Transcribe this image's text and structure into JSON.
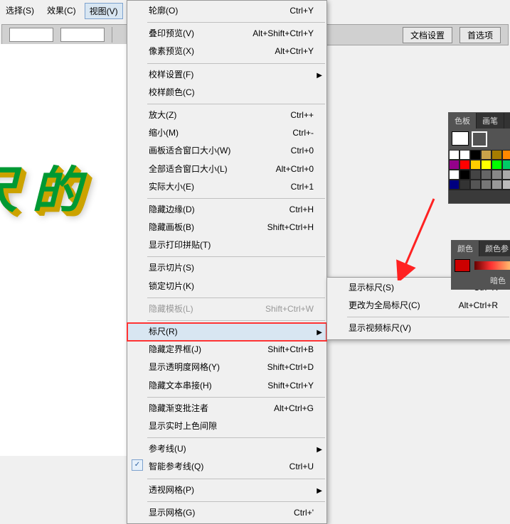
{
  "menubar": {
    "items": [
      "选择(S)",
      "效果(C)",
      "视图(V)"
    ]
  },
  "toolbar": {
    "btn1": "文档设置",
    "btn2": "首选项"
  },
  "canvas_text": "尺 的",
  "menu": {
    "items": [
      {
        "label": "轮廓(O)",
        "shortcut": "Ctrl+Y"
      },
      {
        "sep": true
      },
      {
        "label": "叠印预览(V)",
        "shortcut": "Alt+Shift+Ctrl+Y"
      },
      {
        "label": "像素预览(X)",
        "shortcut": "Alt+Ctrl+Y"
      },
      {
        "sep": true
      },
      {
        "label": "校样设置(F)",
        "submenu": true
      },
      {
        "label": "校样颜色(C)"
      },
      {
        "sep": true
      },
      {
        "label": "放大(Z)",
        "shortcut": "Ctrl++"
      },
      {
        "label": "缩小(M)",
        "shortcut": "Ctrl+-"
      },
      {
        "label": "画板适合窗口大小(W)",
        "shortcut": "Ctrl+0"
      },
      {
        "label": "全部适合窗口大小(L)",
        "shortcut": "Alt+Ctrl+0"
      },
      {
        "label": "实际大小(E)",
        "shortcut": "Ctrl+1"
      },
      {
        "sep": true
      },
      {
        "label": "隐藏边缘(D)",
        "shortcut": "Ctrl+H"
      },
      {
        "label": "隐藏画板(B)",
        "shortcut": "Shift+Ctrl+H"
      },
      {
        "label": "显示打印拼贴(T)"
      },
      {
        "sep": true
      },
      {
        "label": "显示切片(S)"
      },
      {
        "label": "锁定切片(K)"
      },
      {
        "sep": true
      },
      {
        "label": "隐藏模板(L)",
        "shortcut": "Shift+Ctrl+W",
        "disabled": true
      },
      {
        "sep": true
      },
      {
        "label": "标尺(R)",
        "submenu": true,
        "highlight": true
      },
      {
        "label": "隐藏定界框(J)",
        "shortcut": "Shift+Ctrl+B"
      },
      {
        "label": "显示透明度网格(Y)",
        "shortcut": "Shift+Ctrl+D"
      },
      {
        "label": "隐藏文本串接(H)",
        "shortcut": "Shift+Ctrl+Y"
      },
      {
        "sep": true
      },
      {
        "label": "隐藏渐变批注者",
        "shortcut": "Alt+Ctrl+G"
      },
      {
        "label": "显示实时上色间隙"
      },
      {
        "sep": true
      },
      {
        "label": "参考线(U)",
        "submenu": true
      },
      {
        "label": "智能参考线(Q)",
        "shortcut": "Ctrl+U",
        "checked": true
      },
      {
        "sep": true
      },
      {
        "label": "透视网格(P)",
        "submenu": true
      },
      {
        "sep": true
      },
      {
        "label": "显示网格(G)",
        "shortcut": "Ctrl+'"
      }
    ]
  },
  "submenu": {
    "items": [
      {
        "label": "显示标尺(S)",
        "shortcut": "Ctrl+R",
        "highlight": true
      },
      {
        "label": "更改为全局标尺(C)",
        "shortcut": "Alt+Ctrl+R"
      },
      {
        "sep": true
      },
      {
        "label": "显示视频标尺(V)"
      }
    ]
  },
  "swatch_panel": {
    "tabs": [
      "色板",
      "画笔",
      "符"
    ]
  },
  "color_panel": {
    "tabs": [
      "颜色",
      "颜色参"
    ],
    "label": "暗色"
  },
  "swatch_colors": [
    "#ffffff",
    "#ffffff",
    "#000000",
    "#c8a14a",
    "#a67c00",
    "#ff8800",
    "#336600",
    "#339933",
    "#66cc66",
    "#94008a",
    "#ff0000",
    "#ffcc00",
    "#ffff00",
    "#00ff00",
    "#00cc66",
    "#00ffff",
    "#0066cc",
    "#0000cc",
    "#ffffff",
    "#000000",
    "#444444",
    "#666666",
    "#888888",
    "#aaaaaa",
    "#cccccc",
    "#cc0000",
    "#669900",
    "#000080",
    "#333333",
    "#555555",
    "#777777",
    "#999999",
    "#bbbbbb",
    "#dddddd",
    "#ff4488",
    "#88cc44"
  ]
}
